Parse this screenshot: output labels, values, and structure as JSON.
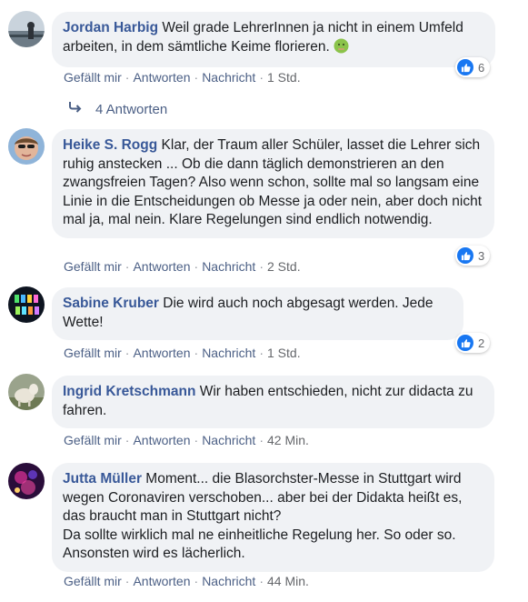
{
  "comments": [
    {
      "author": "Jordan Harbig",
      "text": "Weil grade LehrerInnen ja nicht in einem Umfeld arbeiten, in dem sämtliche Keime florieren.",
      "like_label": "Gefällt mir",
      "reply_label": "Antworten",
      "message_label": "Nachricht",
      "time": "1 Std.",
      "reaction_count": "6"
    },
    {
      "author": "Heike S. Rogg",
      "text": "Klar, der Traum aller Schüler, lasset die Lehrer sich ruhig anstecken ... Ob die dann täglich demonstrieren an den zwangsfreien Tagen? Also wenn schon, sollte mal so langsam eine Linie in die Entscheidungen ob Messe ja oder nein, aber doch nicht mal ja, mal nein. Klare Regelungen sind endlich notwendig.",
      "like_label": "Gefällt mir",
      "reply_label": "Antworten",
      "message_label": "Nachricht",
      "time": "2 Std.",
      "reaction_count": "3"
    },
    {
      "author": "Sabine Kruber",
      "text": "Die wird auch noch abgesagt werden. Jede Wette!",
      "like_label": "Gefällt mir",
      "reply_label": "Antworten",
      "message_label": "Nachricht",
      "time": "1 Std.",
      "reaction_count": "2"
    },
    {
      "author": "Ingrid Kretschmann",
      "text": "Wir haben entschieden, nicht zur didacta zu fahren.",
      "like_label": "Gefällt mir",
      "reply_label": "Antworten",
      "message_label": "Nachricht",
      "time": "42 Min."
    },
    {
      "author": "Jutta Müller",
      "text": "Moment... die Blasorchster-Messe in Stuttgart wird wegen Coronaviren verschoben... aber bei der Didakta heißt es, das braucht man in Stuttgart nicht?\nDa sollte wirklich mal ne einheitliche Regelung her. So oder so. Ansonsten wird es lächerlich.",
      "like_label": "Gefällt mir",
      "reply_label": "Antworten",
      "message_label": "Nachricht",
      "time": "44 Min."
    }
  ],
  "replies_link": "4 Antworten",
  "colors": {
    "author": "#385898",
    "bubble": "#f0f2f5",
    "like_blue": "#1877f2",
    "action_link": "#4b5f85"
  },
  "icons": {
    "like": "thumbs-up-icon",
    "reply_arrow": "reply-arrow-icon",
    "emoji": "nauseated-face-emoji"
  }
}
